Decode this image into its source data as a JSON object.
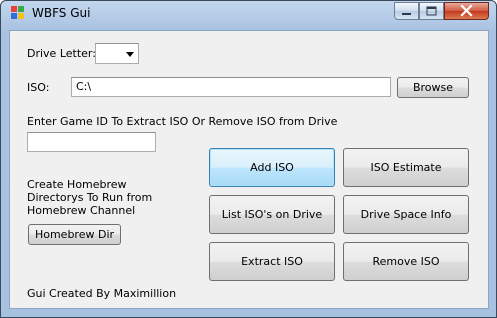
{
  "window": {
    "title": "WBFS Gui",
    "controls": {
      "minimize": "minimize-icon",
      "maximize": "maximize-icon",
      "close": "close-icon"
    }
  },
  "drive": {
    "label": "Drive Letter:",
    "value": ""
  },
  "iso": {
    "label": "ISO:",
    "value": "C:\\",
    "browse_label": "Browse"
  },
  "game_id": {
    "label": "Enter Game ID To Extract ISO Or Remove ISO from Drive",
    "value": ""
  },
  "homebrew": {
    "lines": [
      "Create Homebrew",
      "Directorys To Run from",
      "Homebrew Channel"
    ],
    "button_label": "Homebrew Dir"
  },
  "actions": {
    "add_iso": "Add ISO",
    "iso_estimate": "ISO Estimate",
    "list_isos": "List ISO's on Drive",
    "drive_space": "Drive Space Info",
    "extract_iso": "Extract ISO",
    "remove_iso": "Remove ISO"
  },
  "credit": "Gui Created By Maximillion",
  "colors": {
    "frame": "#a9c2e2",
    "client": "#f0f0f0",
    "close": "#c2391c",
    "focus": "#3c7fb1"
  }
}
